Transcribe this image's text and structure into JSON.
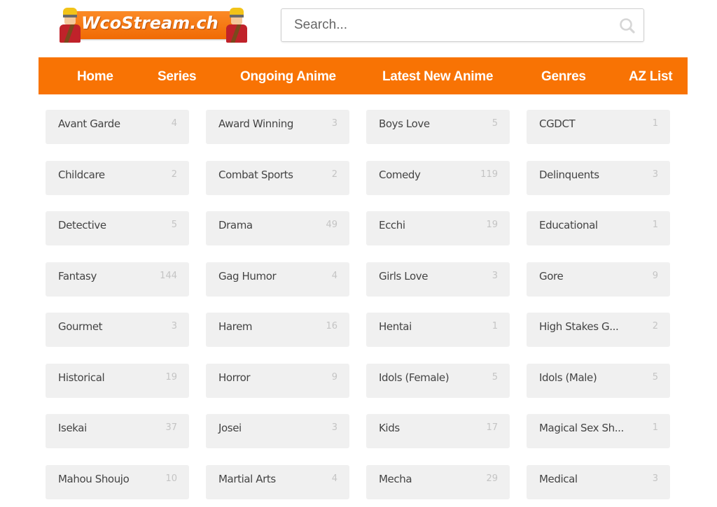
{
  "header": {
    "logo_text": "WcoStream.ch",
    "search": {
      "placeholder": "Search...",
      "value": "",
      "icon": "search-icon"
    }
  },
  "nav": {
    "items": [
      {
        "label": "Home"
      },
      {
        "label": "Series"
      },
      {
        "label": "Ongoing Anime"
      },
      {
        "label": "Latest New Anime"
      },
      {
        "label": "Genres"
      },
      {
        "label": "AZ List"
      }
    ]
  },
  "colors": {
    "brand_orange": "#f87304",
    "tile_bg": "#f0f0f0",
    "genre_text": "#444444",
    "count_text": "#c4c4c4"
  },
  "genres": [
    {
      "name": "Avant Garde",
      "count": "4"
    },
    {
      "name": "Award Winning",
      "count": "3"
    },
    {
      "name": "Boys Love",
      "count": "5"
    },
    {
      "name": "CGDCT",
      "count": "1"
    },
    {
      "name": "Childcare",
      "count": "2"
    },
    {
      "name": "Combat Sports",
      "count": "2"
    },
    {
      "name": "Comedy",
      "count": "119"
    },
    {
      "name": "Delinquents",
      "count": "3"
    },
    {
      "name": "Detective",
      "count": "5"
    },
    {
      "name": "Drama",
      "count": "49"
    },
    {
      "name": "Ecchi",
      "count": "19"
    },
    {
      "name": "Educational",
      "count": "1"
    },
    {
      "name": "Fantasy",
      "count": "144"
    },
    {
      "name": "Gag Humor",
      "count": "4"
    },
    {
      "name": "Girls Love",
      "count": "3"
    },
    {
      "name": "Gore",
      "count": "9"
    },
    {
      "name": "Gourmet",
      "count": "3"
    },
    {
      "name": "Harem",
      "count": "16"
    },
    {
      "name": "Hentai",
      "count": "1"
    },
    {
      "name": "High Stakes G...",
      "count": "2"
    },
    {
      "name": "Historical",
      "count": "19"
    },
    {
      "name": "Horror",
      "count": "9"
    },
    {
      "name": "Idols (Female)",
      "count": "5"
    },
    {
      "name": "Idols (Male)",
      "count": "5"
    },
    {
      "name": "Isekai",
      "count": "37"
    },
    {
      "name": "Josei",
      "count": "3"
    },
    {
      "name": "Kids",
      "count": "17"
    },
    {
      "name": "Magical Sex Sh...",
      "count": "1"
    },
    {
      "name": "Mahou Shoujo",
      "count": "10"
    },
    {
      "name": "Martial Arts",
      "count": "4"
    },
    {
      "name": "Mecha",
      "count": "29"
    },
    {
      "name": "Medical",
      "count": "3"
    }
  ]
}
